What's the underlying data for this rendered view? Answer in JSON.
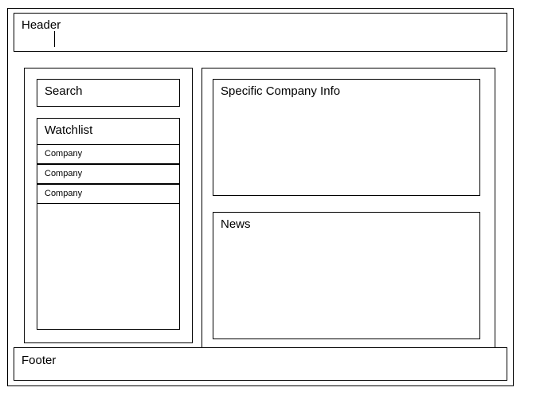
{
  "header": {
    "label": "Header"
  },
  "sidebar": {
    "search_label": "Search",
    "watchlist": {
      "title": "Watchlist",
      "items": [
        {
          "label": "Company"
        },
        {
          "label": "Company"
        },
        {
          "label": "Company"
        }
      ]
    }
  },
  "main": {
    "company_info_label": "Specific Company Info",
    "news_label": "News"
  },
  "footer": {
    "label": "Footer"
  }
}
